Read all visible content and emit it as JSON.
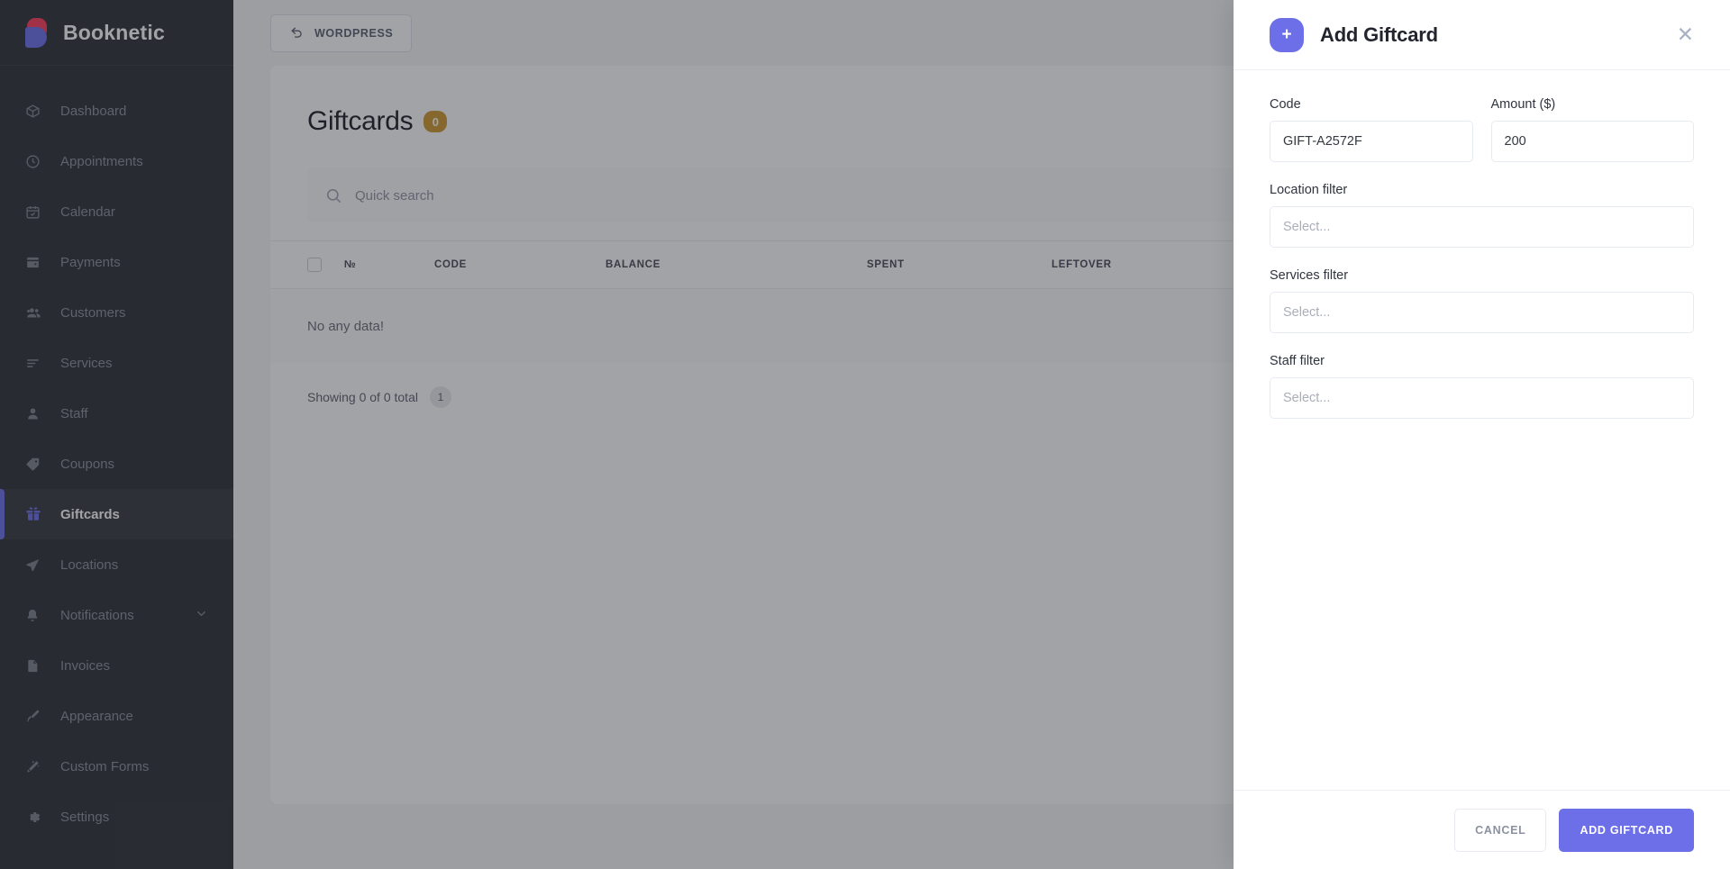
{
  "brand": {
    "name": "Booknetic",
    "logo_icon": "booknetic-logo-icon"
  },
  "sidebar": {
    "items": [
      {
        "label": "Dashboard",
        "icon": "cube-icon",
        "active": false,
        "chevron": false
      },
      {
        "label": "Appointments",
        "icon": "clock-icon",
        "active": false,
        "chevron": false
      },
      {
        "label": "Calendar",
        "icon": "calendar-icon",
        "active": false,
        "chevron": false
      },
      {
        "label": "Payments",
        "icon": "wallet-icon",
        "active": false,
        "chevron": false
      },
      {
        "label": "Customers",
        "icon": "users-icon",
        "active": false,
        "chevron": false
      },
      {
        "label": "Services",
        "icon": "list-icon",
        "active": false,
        "chevron": false
      },
      {
        "label": "Staff",
        "icon": "person-icon",
        "active": false,
        "chevron": false
      },
      {
        "label": "Coupons",
        "icon": "tag-icon",
        "active": false,
        "chevron": false
      },
      {
        "label": "Giftcards",
        "icon": "gift-icon",
        "active": true,
        "chevron": false
      },
      {
        "label": "Locations",
        "icon": "send-icon",
        "active": false,
        "chevron": false
      },
      {
        "label": "Notifications",
        "icon": "bell-icon",
        "active": false,
        "chevron": true
      },
      {
        "label": "Invoices",
        "icon": "document-icon",
        "active": false,
        "chevron": false
      },
      {
        "label": "Appearance",
        "icon": "paintbrush-icon",
        "active": false,
        "chevron": false
      },
      {
        "label": "Custom Forms",
        "icon": "magic-wand-icon",
        "active": false,
        "chevron": false
      },
      {
        "label": "Settings",
        "icon": "gear-icon",
        "active": false,
        "chevron": false
      }
    ]
  },
  "topbar": {
    "wordpress_label": "WORDPRESS",
    "wordpress_icon": "back-arrow-icon"
  },
  "page": {
    "title": "Giftcards",
    "count_badge": "0",
    "count_badge_color": "#cf9a32"
  },
  "search": {
    "placeholder": "Quick search",
    "value": "",
    "icon": "search-icon"
  },
  "table": {
    "columns": [
      "№",
      "CODE",
      "BALANCE",
      "SPENT",
      "LEFTOVER"
    ],
    "rows": [],
    "empty_text": "No any data!",
    "footer_text": "Showing 0 of 0 total",
    "current_page": "1"
  },
  "modal": {
    "title": "Add Giftcard",
    "badge_icon": "plus-icon",
    "badge_label": "+",
    "close_icon": "close-icon",
    "accent_color": "#6c6fe8",
    "fields": {
      "code": {
        "label": "Code",
        "value": "GIFT-A2572F",
        "placeholder": ""
      },
      "amount": {
        "label": "Amount ($)",
        "value": "200",
        "placeholder": ""
      },
      "location_filter": {
        "label": "Location filter",
        "value": "Select..."
      },
      "services_filter": {
        "label": "Services filter",
        "value": "Select..."
      },
      "staff_filter": {
        "label": "Staff filter",
        "value": "Select..."
      }
    },
    "footer": {
      "cancel_label": "CANCEL",
      "submit_label": "ADD GIFTCARD"
    }
  }
}
